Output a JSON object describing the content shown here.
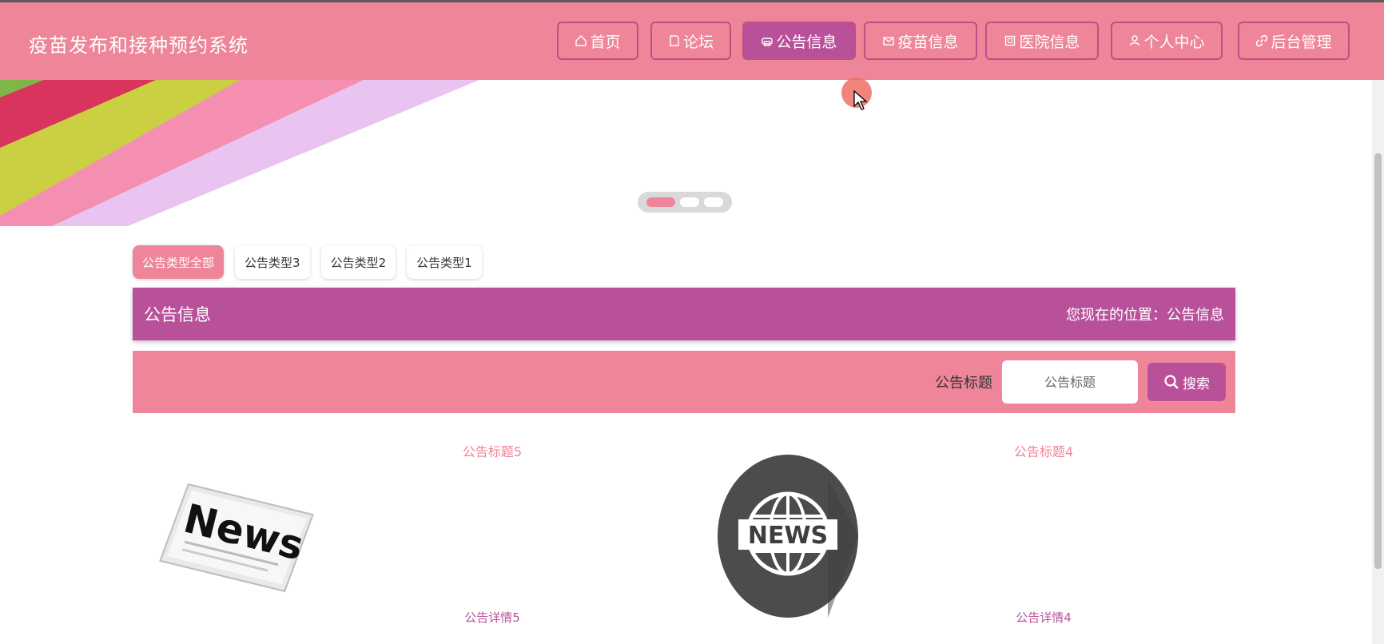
{
  "site": {
    "title": "疫苗发布和接种预约系统"
  },
  "nav": [
    {
      "label": "首页",
      "icon": "home-icon"
    },
    {
      "label": "论坛",
      "icon": "document-icon"
    },
    {
      "label": "公告信息",
      "icon": "printer-icon",
      "active": true
    },
    {
      "label": "疫苗信息",
      "icon": "mail-icon"
    },
    {
      "label": "医院信息",
      "icon": "building-icon"
    },
    {
      "label": "个人中心",
      "icon": "user-icon"
    },
    {
      "label": "后台管理",
      "icon": "link-icon"
    }
  ],
  "carousel": {
    "slides": 3,
    "active_index": 0
  },
  "category_tabs": [
    {
      "label": "公告类型全部",
      "active": true
    },
    {
      "label": "公告类型3"
    },
    {
      "label": "公告类型2"
    },
    {
      "label": "公告类型1"
    }
  ],
  "title_bar": {
    "title": "公告信息",
    "location_label": "您现在的位置：",
    "location_value": "公告信息"
  },
  "search": {
    "label": "公告标题",
    "placeholder": "公告标题",
    "button_label": "搜索"
  },
  "notices": [
    {
      "title": "公告标题5",
      "detail": "公告详情5",
      "image": "newspaper-image"
    },
    {
      "title": "公告标题4",
      "detail": "公告详情4",
      "image": "news-globe-image"
    }
  ],
  "colors": {
    "primary": "#ee8599",
    "accent": "#b9519a"
  }
}
